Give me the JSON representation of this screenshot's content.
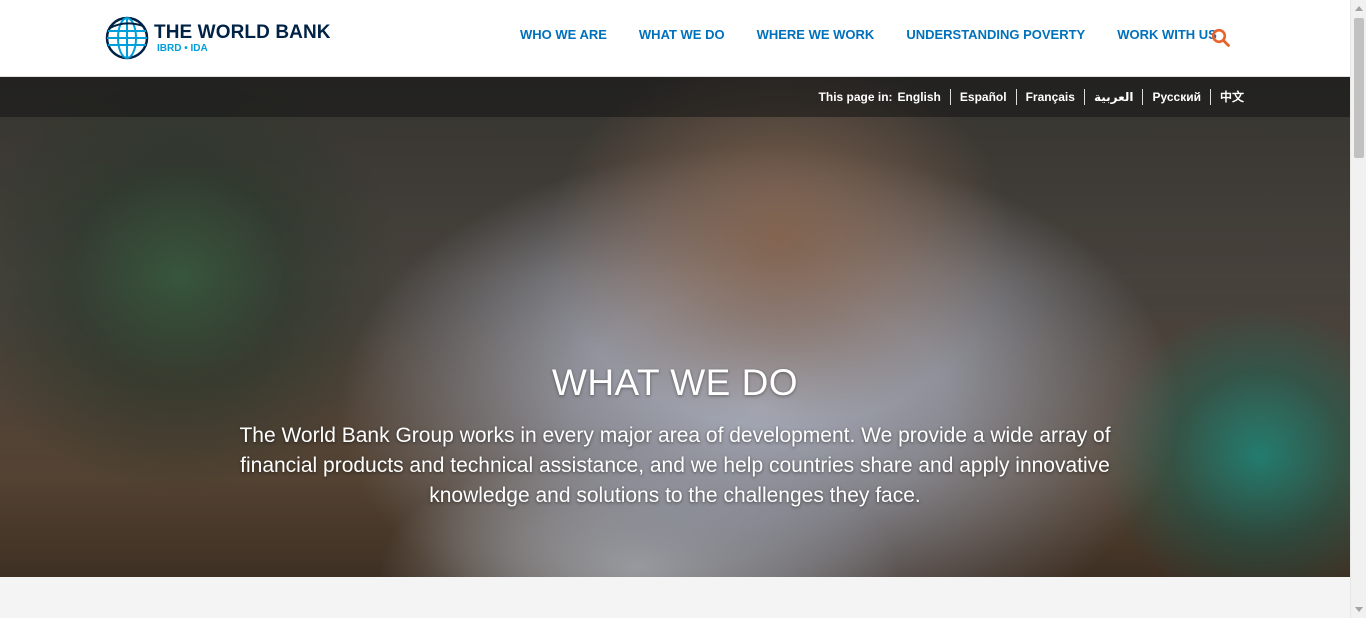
{
  "header": {
    "logo": {
      "title": "THE WORLD BANK",
      "subtitle": "IBRD • IDA"
    },
    "nav": [
      {
        "label": "WHO WE ARE"
      },
      {
        "label": "WHAT WE DO"
      },
      {
        "label": "WHERE WE WORK"
      },
      {
        "label": "UNDERSTANDING POVERTY"
      },
      {
        "label": "WORK WITH US"
      }
    ],
    "search_icon": "search-icon"
  },
  "language_bar": {
    "label": "This page in:",
    "languages": [
      "English",
      "Español",
      "Français",
      "العربية",
      "Русский",
      "中文"
    ]
  },
  "hero": {
    "title": "WHAT WE DO",
    "description": "The World Bank Group works in every major area of development. We provide a wide array of financial products and technical assistance, and we help countries share and apply innovative knowledge and solutions to the challenges they face."
  },
  "colors": {
    "brand_navy": "#002244",
    "brand_blue": "#009fda",
    "nav_blue": "#0071bc",
    "search_orange": "#e8642c"
  }
}
